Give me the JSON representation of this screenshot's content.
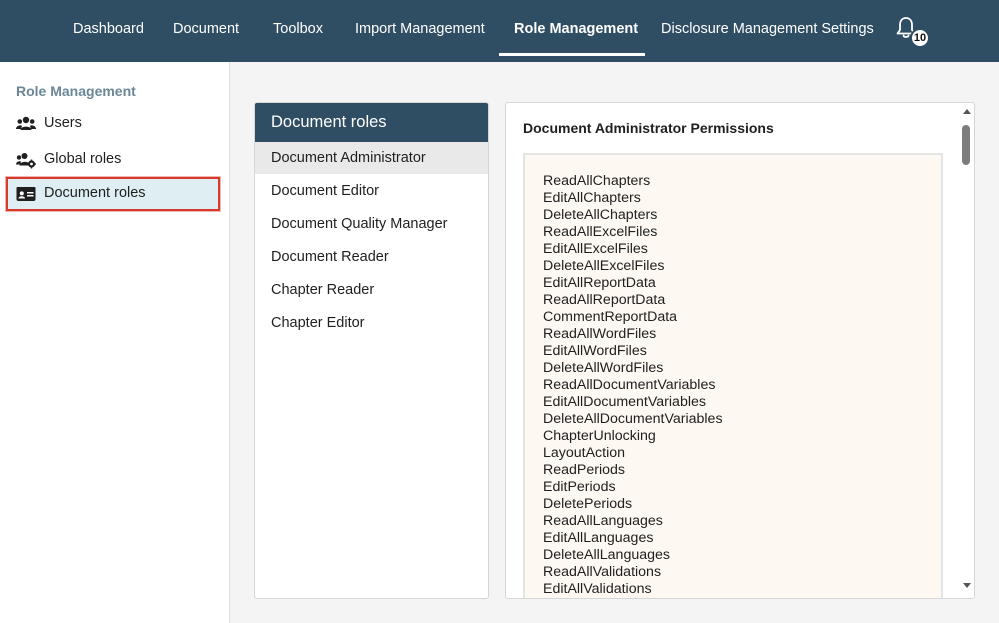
{
  "nav": {
    "items": [
      "Dashboard",
      "Document",
      "Toolbox",
      "Import Management",
      "Role Management",
      "Disclosure Management Settings"
    ],
    "active": "Role Management",
    "notifications_count": "10"
  },
  "sidebar": {
    "heading": "Role Management",
    "items": [
      {
        "label": "Users",
        "icon": "users-icon"
      },
      {
        "label": "Global roles",
        "icon": "global-roles-icon"
      },
      {
        "label": "Document roles",
        "icon": "id-card-icon"
      }
    ],
    "selected": "Document roles"
  },
  "roles_panel": {
    "title": "Document roles",
    "roles": [
      "Document Administrator",
      "Document Editor",
      "Document Quality Manager",
      "Document Reader",
      "Chapter Reader",
      "Chapter Editor"
    ],
    "selected": "Document Administrator"
  },
  "permissions_panel": {
    "title": "Document Administrator Permissions",
    "permissions": [
      "ReadAllChapters",
      "EditAllChapters",
      "DeleteAllChapters",
      "ReadAllExcelFiles",
      "EditAllExcelFiles",
      "DeleteAllExcelFiles",
      "EditAllReportData",
      "ReadAllReportData",
      "CommentReportData",
      "ReadAllWordFiles",
      "EditAllWordFiles",
      "DeleteAllWordFiles",
      "ReadAllDocumentVariables",
      "EditAllDocumentVariables",
      "DeleteAllDocumentVariables",
      "ChapterUnlocking",
      "LayoutAction",
      "ReadPeriods",
      "EditPeriods",
      "DeletePeriods",
      "ReadAllLanguages",
      "EditAllLanguages",
      "DeleteAllLanguages",
      "ReadAllValidations",
      "EditAllValidations"
    ]
  },
  "colors": {
    "header_bg": "#2f4e64",
    "selected_highlight": "#d83a2e",
    "selected_bg": "#deeef3",
    "permissions_bg": "#fdf8f1"
  }
}
